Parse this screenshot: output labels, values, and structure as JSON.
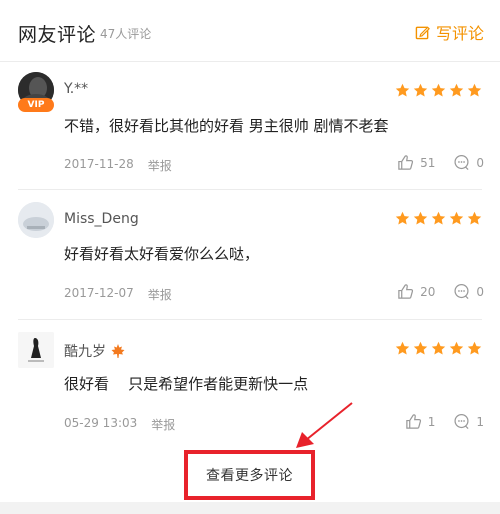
{
  "header": {
    "title": "网友评论",
    "count": "47人评论",
    "write_label": "写评论"
  },
  "comments": [
    {
      "user": "Y.**",
      "vip_label": "VIP",
      "content": "不错，很好看比其他的好看 男主很帅 剧情不老套",
      "date": "2017-11-28",
      "report": "举报",
      "likes": "51",
      "replies": "0",
      "rating": 5
    },
    {
      "user": "Miss_Deng",
      "content": "好看好看太好看爱你么么哒，",
      "date": "2017-12-07",
      "report": "举报",
      "likes": "20",
      "replies": "0",
      "rating": 5
    },
    {
      "user": "酷九岁",
      "content": "很好看    只是希望作者能更新快一点",
      "date": "05-29 13:03",
      "report": "举报",
      "likes": "1",
      "replies": "1",
      "rating": 5
    }
  ],
  "more": {
    "label": "查看更多评论"
  },
  "colors": {
    "accent": "#f39200",
    "star": "#ff9a1f",
    "highlight": "#e8222b",
    "vip": "#ff7a1a"
  },
  "icons": [
    "edit-icon",
    "star-icon",
    "thumbs-up-icon",
    "comment-bubble-icon",
    "maple-leaf-icon",
    "arrow-icon"
  ]
}
